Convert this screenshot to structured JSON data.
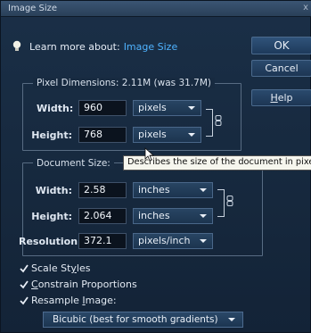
{
  "window": {
    "title": "Image Size",
    "close_glyph": "x"
  },
  "learn": {
    "prefix": "Learn more about:",
    "link": "Image Size",
    "icon": "lightbulb-icon"
  },
  "buttons": {
    "ok": "OK",
    "cancel": "Cancel",
    "help_first": "H",
    "help_rest": "elp"
  },
  "pixel_dimensions": {
    "legend": "Pixel Dimensions:  2.11M (was 31.7M)",
    "width_label": "Width:",
    "width_value": "960",
    "width_unit": "pixels",
    "height_label": "Height:",
    "height_value": "768",
    "height_unit": "pixels"
  },
  "document_size": {
    "legend": "Document Size:",
    "width_label": "Width:",
    "width_value": "2.58",
    "width_unit": "inches",
    "height_label": "Height:",
    "height_value": "2.064",
    "height_unit": "inches",
    "resolution_label": "Resolution:",
    "resolution_value": "372.1",
    "resolution_unit": "pixels/inch"
  },
  "tooltip": "Describes the size of the document in pixels",
  "options": {
    "scale_styles_a": "Scale St",
    "scale_styles_u": "y",
    "scale_styles_b": "les",
    "constrain_u": "C",
    "constrain_rest": "onstrain Proportions",
    "resample_a": "Resample ",
    "resample_u": "I",
    "resample_b": "mage:",
    "resample_method": "Bicubic (best for smooth gradients)"
  },
  "colors": {
    "link": "#4fb3ff",
    "background": "#16283d",
    "tooltip_bg": "#f6f6ee"
  }
}
